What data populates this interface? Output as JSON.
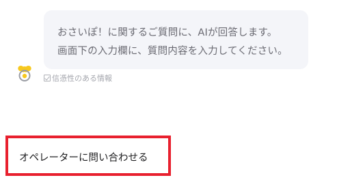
{
  "chat": {
    "message_lines": [
      "おさいぽ！に関するご質問に、AIが回答します。",
      "画面下の入力欄に、質問内容を入力してください。"
    ],
    "trust_label": "信憑性のある情報",
    "avatar_icon": "mascot-icon"
  },
  "actions": {
    "operator_button_label": "オペレーターに問い合わせる",
    "highlight_color": "#e8202e"
  }
}
